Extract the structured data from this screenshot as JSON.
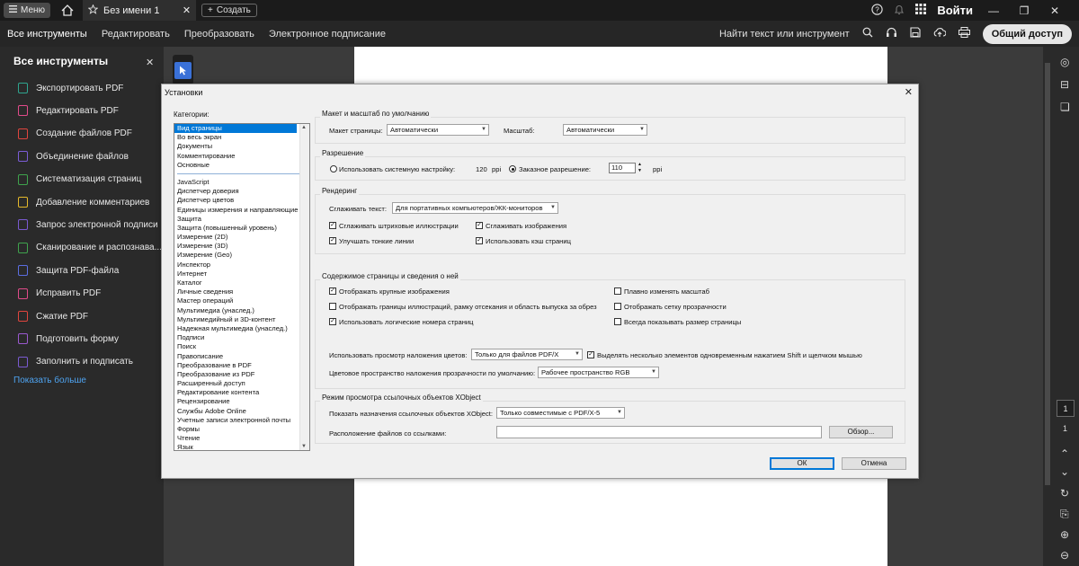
{
  "titlebar": {
    "menu_label": "Меню",
    "doc_tab_title": "Без имени 1",
    "new_label": "Создать",
    "login_label": "Войти"
  },
  "toolbar": {
    "tabs": [
      "Все инструменты",
      "Редактировать",
      "Преобразовать",
      "Электронное подписание"
    ],
    "find_label": "Найти текст или инструмент",
    "share_label": "Общий доступ"
  },
  "left_panel": {
    "title": "Все инструменты",
    "items": [
      {
        "label": "Экспортировать PDF",
        "color": "#2fa58f"
      },
      {
        "label": "Редактировать PDF",
        "color": "#e14b8a"
      },
      {
        "label": "Создание файлов PDF",
        "color": "#e0453e"
      },
      {
        "label": "Объединение файлов",
        "color": "#7b5cd6"
      },
      {
        "label": "Систематизация страниц",
        "color": "#3fa34d"
      },
      {
        "label": "Добавление комментариев",
        "color": "#e5b92b"
      },
      {
        "label": "Запрос электронной подписи",
        "color": "#7a5ad1"
      },
      {
        "label": "Сканирование и распознава...",
        "color": "#3fa34d"
      },
      {
        "label": "Защита PDF-файла",
        "color": "#5b6ee1"
      },
      {
        "label": "Исправить PDF",
        "color": "#e14b8a"
      },
      {
        "label": "Сжатие PDF",
        "color": "#e0453e"
      },
      {
        "label": "Подготовить форму",
        "color": "#9b59d0"
      },
      {
        "label": "Заполнить и подписать",
        "color": "#7a5ad1"
      }
    ],
    "show_more": "Показать больше"
  },
  "right_rail": {
    "page_number": "1",
    "page_total": "1"
  },
  "dialog": {
    "title": "Установки",
    "categories_label": "Категории:",
    "categories_top": [
      "Вид страницы",
      "Во весь экран",
      "Документы",
      "Комментирование",
      "Основные"
    ],
    "categories_rest": [
      "JavaScript",
      "Диспетчер доверия",
      "Диспетчер цветов",
      "Единицы измерения и направляющие",
      "Защита",
      "Защита (повышенный уровень)",
      "Измерение (2D)",
      "Измерение (3D)",
      "Измерение (Geo)",
      "Инспектор",
      "Интернет",
      "Каталог",
      "Личные сведения",
      "Мастер операций",
      "Мультимедиа (унаслед.)",
      "Мультимедийный и 3D-контент",
      "Надежная мультимедиа (унаслед.)",
      "Подписи",
      "Поиск",
      "Правописание",
      "Преобразование в PDF",
      "Преобразование из PDF",
      "Расширенный доступ",
      "Редактирование контента",
      "Рецензирование",
      "Службы Adobe Online",
      "Учетные записи электронной почты",
      "Формы",
      "Чтение",
      "Язык"
    ],
    "layout": {
      "group": "Макет и масштаб по умолчанию",
      "page_layout_label": "Макет страницы:",
      "page_layout_value": "Автоматически",
      "zoom_label": "Масштаб:",
      "zoom_value": "Автоматически"
    },
    "resolution": {
      "group": "Разрешение",
      "system_label": "Использовать системную настройку:",
      "system_value": "120",
      "system_unit": "ppi",
      "custom_label": "Заказное разрешение:",
      "custom_value": "110",
      "custom_unit": "ppi"
    },
    "rendering": {
      "group": "Рендеринг",
      "smooth_text_label": "Сглаживать текст:",
      "smooth_text_value": "Для портативных компьютеров/ЖК-мониторов",
      "smooth_line_art": "Сглаживать штриховые иллюстрации",
      "smooth_images": "Сглаживать изображения",
      "enhance_thin_lines": "Улучшать тонкие линии",
      "use_page_cache": "Использовать кэш страниц"
    },
    "page_content": {
      "group": "Содержимое страницы и сведения о ней",
      "show_large_images": "Отображать крупные изображения",
      "smooth_zoom": "Плавно изменять масштаб",
      "show_art_boxes": "Отображать границы иллюстраций, рамку отсекания и область выпуска за обрез",
      "show_transparency_grid": "Отображать сетку прозрачности",
      "use_logical_page_numbers": "Использовать логические номера страниц",
      "always_show_page_size": "Всегда показывать размер страницы",
      "overprint_label": "Использовать просмотр наложения цветов:",
      "overprint_value": "Только для файлов PDF/X",
      "shift_select": "Выделять несколько элементов одновременным нажатием Shift и щелчком мышью",
      "blend_space_label": "Цветовое пространство наложения прозрачности по умолчанию:",
      "blend_space_value": "Рабочее пространство RGB"
    },
    "xobject": {
      "group": "Режим просмотра ссылочных объектов XObject",
      "show_targets_label": "Показать назначения ссылочных объектов XObject:",
      "show_targets_value": "Только совместимые с PDF/X-5",
      "location_label": "Расположение файлов со ссылками:",
      "location_value": "",
      "browse_label": "Обзор..."
    },
    "ok_label": "ОК",
    "cancel_label": "Отмена"
  }
}
